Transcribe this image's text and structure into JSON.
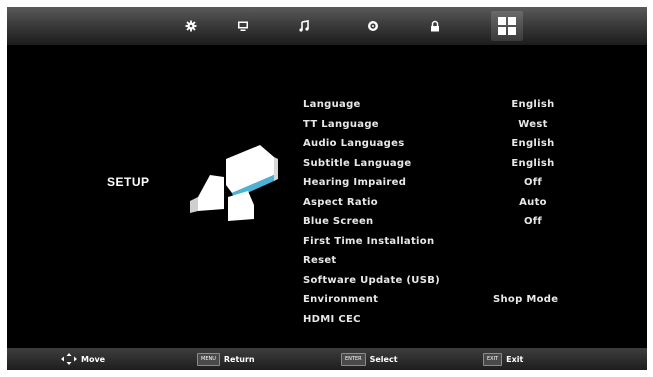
{
  "tabs": [
    {
      "icon": "gear-icon"
    },
    {
      "icon": "monitor-icon"
    },
    {
      "icon": "music-note-icon"
    },
    {
      "icon": "clock-icon"
    },
    {
      "icon": "lock-icon"
    },
    {
      "icon": "grid-icon",
      "active": true
    }
  ],
  "page": {
    "title": "SETUP"
  },
  "menu": {
    "items": [
      {
        "label": "Language",
        "value": "English"
      },
      {
        "label": "TT Language",
        "value": "West"
      },
      {
        "label": "Audio Languages",
        "value": "English"
      },
      {
        "label": "Subtitle Language",
        "value": "English"
      },
      {
        "label": "Hearing Impaired",
        "value": "Off"
      },
      {
        "label": "Aspect Ratio",
        "value": "Auto"
      },
      {
        "label": "Blue Screen",
        "value": "Off"
      },
      {
        "label": "First Time Installation",
        "value": ""
      },
      {
        "label": "Reset",
        "value": ""
      },
      {
        "label": "Software Update (USB)",
        "value": ""
      },
      {
        "label": "Environment",
        "value": "Shop Mode"
      },
      {
        "label": "HDMI CEC",
        "value": ""
      }
    ]
  },
  "hints": {
    "move": {
      "label": "Move"
    },
    "return": {
      "key": "MENU",
      "label": "Return"
    },
    "select": {
      "key": "ENTER",
      "label": "Select"
    },
    "exit": {
      "key": "EXIT",
      "label": "Exit"
    }
  },
  "colors": {
    "background": "#000000",
    "text": "#e8e8e8",
    "accent": "#4ab3d6"
  }
}
